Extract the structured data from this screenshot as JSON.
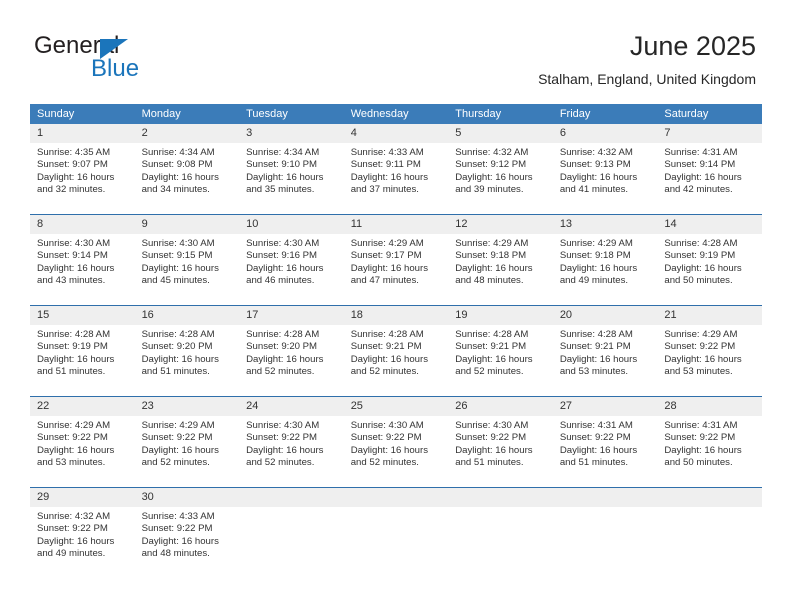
{
  "brand": {
    "name_primary": "General",
    "name_secondary": "Blue",
    "triangle_color": "#1b75bb"
  },
  "header": {
    "title": "June 2025",
    "subtitle": "Stalham, England, United Kingdom",
    "accent_color": "#3b7cb9",
    "row_divider_color": "#2f6fab",
    "daynum_bg": "#efefef"
  },
  "weekdays": [
    "Sunday",
    "Monday",
    "Tuesday",
    "Wednesday",
    "Thursday",
    "Friday",
    "Saturday"
  ],
  "labels": {
    "sunrise_prefix": "Sunrise:",
    "sunset_prefix": "Sunset:",
    "daylight_prefix": "Daylight:"
  },
  "weeks": [
    [
      {
        "day": "1",
        "sunrise": "Sunrise: 4:35 AM",
        "sunset": "Sunset: 9:07 PM",
        "daylight1": "Daylight: 16 hours",
        "daylight2": "and 32 minutes."
      },
      {
        "day": "2",
        "sunrise": "Sunrise: 4:34 AM",
        "sunset": "Sunset: 9:08 PM",
        "daylight1": "Daylight: 16 hours",
        "daylight2": "and 34 minutes."
      },
      {
        "day": "3",
        "sunrise": "Sunrise: 4:34 AM",
        "sunset": "Sunset: 9:10 PM",
        "daylight1": "Daylight: 16 hours",
        "daylight2": "and 35 minutes."
      },
      {
        "day": "4",
        "sunrise": "Sunrise: 4:33 AM",
        "sunset": "Sunset: 9:11 PM",
        "daylight1": "Daylight: 16 hours",
        "daylight2": "and 37 minutes."
      },
      {
        "day": "5",
        "sunrise": "Sunrise: 4:32 AM",
        "sunset": "Sunset: 9:12 PM",
        "daylight1": "Daylight: 16 hours",
        "daylight2": "and 39 minutes."
      },
      {
        "day": "6",
        "sunrise": "Sunrise: 4:32 AM",
        "sunset": "Sunset: 9:13 PM",
        "daylight1": "Daylight: 16 hours",
        "daylight2": "and 41 minutes."
      },
      {
        "day": "7",
        "sunrise": "Sunrise: 4:31 AM",
        "sunset": "Sunset: 9:14 PM",
        "daylight1": "Daylight: 16 hours",
        "daylight2": "and 42 minutes."
      }
    ],
    [
      {
        "day": "8",
        "sunrise": "Sunrise: 4:30 AM",
        "sunset": "Sunset: 9:14 PM",
        "daylight1": "Daylight: 16 hours",
        "daylight2": "and 43 minutes."
      },
      {
        "day": "9",
        "sunrise": "Sunrise: 4:30 AM",
        "sunset": "Sunset: 9:15 PM",
        "daylight1": "Daylight: 16 hours",
        "daylight2": "and 45 minutes."
      },
      {
        "day": "10",
        "sunrise": "Sunrise: 4:30 AM",
        "sunset": "Sunset: 9:16 PM",
        "daylight1": "Daylight: 16 hours",
        "daylight2": "and 46 minutes."
      },
      {
        "day": "11",
        "sunrise": "Sunrise: 4:29 AM",
        "sunset": "Sunset: 9:17 PM",
        "daylight1": "Daylight: 16 hours",
        "daylight2": "and 47 minutes."
      },
      {
        "day": "12",
        "sunrise": "Sunrise: 4:29 AM",
        "sunset": "Sunset: 9:18 PM",
        "daylight1": "Daylight: 16 hours",
        "daylight2": "and 48 minutes."
      },
      {
        "day": "13",
        "sunrise": "Sunrise: 4:29 AM",
        "sunset": "Sunset: 9:18 PM",
        "daylight1": "Daylight: 16 hours",
        "daylight2": "and 49 minutes."
      },
      {
        "day": "14",
        "sunrise": "Sunrise: 4:28 AM",
        "sunset": "Sunset: 9:19 PM",
        "daylight1": "Daylight: 16 hours",
        "daylight2": "and 50 minutes."
      }
    ],
    [
      {
        "day": "15",
        "sunrise": "Sunrise: 4:28 AM",
        "sunset": "Sunset: 9:19 PM",
        "daylight1": "Daylight: 16 hours",
        "daylight2": "and 51 minutes."
      },
      {
        "day": "16",
        "sunrise": "Sunrise: 4:28 AM",
        "sunset": "Sunset: 9:20 PM",
        "daylight1": "Daylight: 16 hours",
        "daylight2": "and 51 minutes."
      },
      {
        "day": "17",
        "sunrise": "Sunrise: 4:28 AM",
        "sunset": "Sunset: 9:20 PM",
        "daylight1": "Daylight: 16 hours",
        "daylight2": "and 52 minutes."
      },
      {
        "day": "18",
        "sunrise": "Sunrise: 4:28 AM",
        "sunset": "Sunset: 9:21 PM",
        "daylight1": "Daylight: 16 hours",
        "daylight2": "and 52 minutes."
      },
      {
        "day": "19",
        "sunrise": "Sunrise: 4:28 AM",
        "sunset": "Sunset: 9:21 PM",
        "daylight1": "Daylight: 16 hours",
        "daylight2": "and 52 minutes."
      },
      {
        "day": "20",
        "sunrise": "Sunrise: 4:28 AM",
        "sunset": "Sunset: 9:21 PM",
        "daylight1": "Daylight: 16 hours",
        "daylight2": "and 53 minutes."
      },
      {
        "day": "21",
        "sunrise": "Sunrise: 4:29 AM",
        "sunset": "Sunset: 9:22 PM",
        "daylight1": "Daylight: 16 hours",
        "daylight2": "and 53 minutes."
      }
    ],
    [
      {
        "day": "22",
        "sunrise": "Sunrise: 4:29 AM",
        "sunset": "Sunset: 9:22 PM",
        "daylight1": "Daylight: 16 hours",
        "daylight2": "and 53 minutes."
      },
      {
        "day": "23",
        "sunrise": "Sunrise: 4:29 AM",
        "sunset": "Sunset: 9:22 PM",
        "daylight1": "Daylight: 16 hours",
        "daylight2": "and 52 minutes."
      },
      {
        "day": "24",
        "sunrise": "Sunrise: 4:30 AM",
        "sunset": "Sunset: 9:22 PM",
        "daylight1": "Daylight: 16 hours",
        "daylight2": "and 52 minutes."
      },
      {
        "day": "25",
        "sunrise": "Sunrise: 4:30 AM",
        "sunset": "Sunset: 9:22 PM",
        "daylight1": "Daylight: 16 hours",
        "daylight2": "and 52 minutes."
      },
      {
        "day": "26",
        "sunrise": "Sunrise: 4:30 AM",
        "sunset": "Sunset: 9:22 PM",
        "daylight1": "Daylight: 16 hours",
        "daylight2": "and 51 minutes."
      },
      {
        "day": "27",
        "sunrise": "Sunrise: 4:31 AM",
        "sunset": "Sunset: 9:22 PM",
        "daylight1": "Daylight: 16 hours",
        "daylight2": "and 51 minutes."
      },
      {
        "day": "28",
        "sunrise": "Sunrise: 4:31 AM",
        "sunset": "Sunset: 9:22 PM",
        "daylight1": "Daylight: 16 hours",
        "daylight2": "and 50 minutes."
      }
    ],
    [
      {
        "day": "29",
        "sunrise": "Sunrise: 4:32 AM",
        "sunset": "Sunset: 9:22 PM",
        "daylight1": "Daylight: 16 hours",
        "daylight2": "and 49 minutes."
      },
      {
        "day": "30",
        "sunrise": "Sunrise: 4:33 AM",
        "sunset": "Sunset: 9:22 PM",
        "daylight1": "Daylight: 16 hours",
        "daylight2": "and 48 minutes."
      },
      {
        "day": "",
        "sunrise": "",
        "sunset": "",
        "daylight1": "",
        "daylight2": ""
      },
      {
        "day": "",
        "sunrise": "",
        "sunset": "",
        "daylight1": "",
        "daylight2": ""
      },
      {
        "day": "",
        "sunrise": "",
        "sunset": "",
        "daylight1": "",
        "daylight2": ""
      },
      {
        "day": "",
        "sunrise": "",
        "sunset": "",
        "daylight1": "",
        "daylight2": ""
      },
      {
        "day": "",
        "sunrise": "",
        "sunset": "",
        "daylight1": "",
        "daylight2": ""
      }
    ]
  ]
}
